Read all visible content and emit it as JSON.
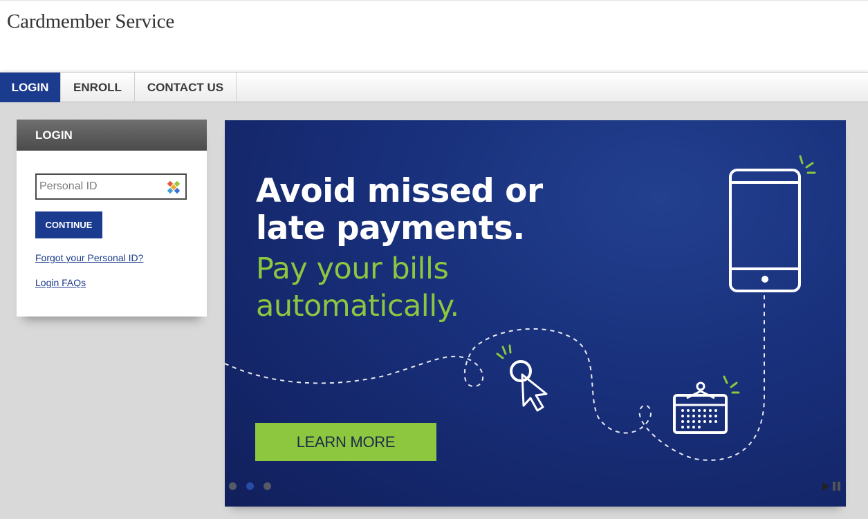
{
  "brand": {
    "name": "Cardmember Service"
  },
  "nav": {
    "tabs": [
      {
        "label": "LOGIN",
        "active": true
      },
      {
        "label": "ENROLL",
        "active": false
      },
      {
        "label": "CONTACT US",
        "active": false
      }
    ]
  },
  "login": {
    "title": "LOGIN",
    "personal_id": {
      "value": "",
      "placeholder": "Personal ID"
    },
    "continue_label": "CONTINUE",
    "forgot_link": "Forgot your Personal ID?",
    "faq_link": "Login FAQs"
  },
  "banner": {
    "headline_line1": "Avoid missed or",
    "headline_line2": "late payments.",
    "subline_line1": "Pay your bills",
    "subline_line2": "automatically.",
    "cta_label": "LEARN MORE",
    "slides": 3,
    "active_slide": 2
  },
  "colors": {
    "primary_blue": "#1b3b8f",
    "banner_bg": "#182f7a",
    "accent_green": "#8dc63f",
    "page_bg": "#d9d9d9"
  },
  "icons": [
    "password-manager-icon",
    "phone-icon",
    "cursor-click-icon",
    "calendar-icon",
    "play-icon",
    "pause-icon"
  ]
}
